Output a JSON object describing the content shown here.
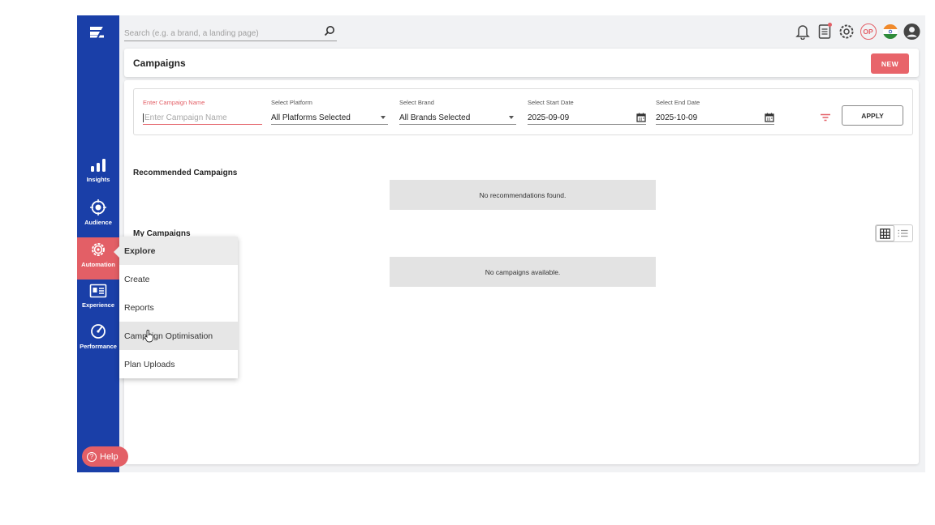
{
  "search": {
    "placeholder": "Search (e.g. a brand, a landing page)"
  },
  "sidebar": {
    "items": [
      {
        "label": "Insights",
        "icon": "bar-chart-icon"
      },
      {
        "label": "Audience",
        "icon": "target-icon"
      },
      {
        "label": "Automation",
        "icon": "gear-icon",
        "active": true
      },
      {
        "label": "Experience",
        "icon": "id-card-icon"
      },
      {
        "label": "Performance",
        "icon": "gauge-icon"
      }
    ],
    "help_label": "Help"
  },
  "topbar": {
    "icons": [
      "bell-icon",
      "document-icon",
      "settings-icon",
      "user-initials-badge",
      "india-flag-icon",
      "account-icon"
    ],
    "initials": "OP"
  },
  "header": {
    "title": "Campaigns",
    "new_label": "NEW"
  },
  "filters": {
    "campaign_name": {
      "label": "Enter Campaign Name",
      "placeholder": "Enter Campaign Name",
      "value": ""
    },
    "platform": {
      "label": "Select Platform",
      "value": "All Platforms Selected"
    },
    "brand": {
      "label": "Select Brand",
      "value": "All Brands Selected"
    },
    "start_date": {
      "label": "Select Start Date",
      "value": "2025-09-09"
    },
    "end_date": {
      "label": "Select End Date",
      "value": "2025-10-09"
    },
    "apply_label": "APPLY"
  },
  "recommended": {
    "title": "Recommended Campaigns",
    "empty_text": "No recommendations found."
  },
  "my_campaigns": {
    "title": "My Campaigns",
    "empty_text": "No campaigns available."
  },
  "automation_menu": {
    "items": [
      "Explore",
      "Create",
      "Reports",
      "Campaign Optimisation",
      "Plan Uploads"
    ]
  },
  "colors": {
    "sidebar": "#1a3fa8",
    "accent": "#e35f66"
  }
}
